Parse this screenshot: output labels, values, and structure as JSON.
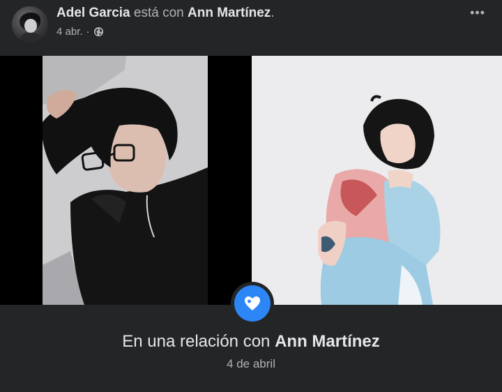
{
  "post": {
    "author": "Adel Garcia",
    "with_text": "está con",
    "tagged": "Ann Martínez",
    "tagged_period": ".",
    "timestamp": "4 abr.",
    "separator": "·",
    "privacy_icon": "globe-icon",
    "more_icon": "more-options-icon",
    "more_label": "•••"
  },
  "event": {
    "icon": "heart-icon",
    "prefix": "En una relación con",
    "partner": "Ann Martínez",
    "date": "4 de abril"
  },
  "colors": {
    "background": "#242526",
    "text_primary": "#e4e6eb",
    "text_secondary": "#b0b3b8",
    "accent": "#2d86f5"
  }
}
